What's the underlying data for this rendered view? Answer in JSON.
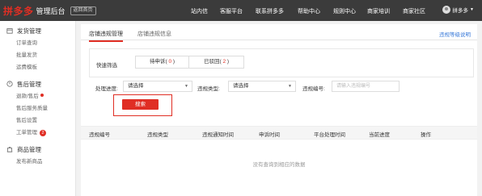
{
  "header": {
    "logo": "拼多多",
    "logo_sub": "管理后台",
    "home_btn": "返回首页",
    "nav": [
      "站内信",
      "客服平台",
      "联系拼多多",
      "帮助中心",
      "规则中心",
      "商家培训",
      "商家社区"
    ],
    "user_name": "拼多多"
  },
  "sidebar": {
    "sections": [
      {
        "title": "发货管理",
        "items": [
          "订单查询",
          "批量发货",
          "运费模板"
        ]
      },
      {
        "title": "售后管理",
        "items": [
          "退款/售后",
          "售后服务质量",
          "售后设置",
          "工单管理"
        ]
      },
      {
        "title": "商品管理",
        "items": [
          "发布新商品"
        ]
      }
    ],
    "ticket_badge": "2"
  },
  "tabs": [
    "店铺违规管理",
    "店铺违规信息"
  ],
  "help_link": "违规等级说明",
  "quick_filter": {
    "label": "快速筛选",
    "chips": [
      {
        "text": "待申诉",
        "count": "0"
      },
      {
        "text": "已驳回",
        "count": "2"
      }
    ]
  },
  "filters": {
    "progress_label": "处理进度:",
    "progress_value": "请选择",
    "type_label": "违规类型:",
    "type_value": "请选择",
    "id_label": "违规编号:",
    "id_placeholder": "请输入违规编号"
  },
  "search_button": "搜索",
  "table": {
    "headers": [
      "违规编号",
      "违规类型",
      "违规通知时间",
      "申诉时间",
      "平台处理时间",
      "当前进度",
      "操作"
    ],
    "empty_text": "没有查询到相应的数据"
  },
  "colors": {
    "brand_red": "#e02e24",
    "topbar": "#3b3b3b",
    "link_blue": "#3a7ad9"
  }
}
